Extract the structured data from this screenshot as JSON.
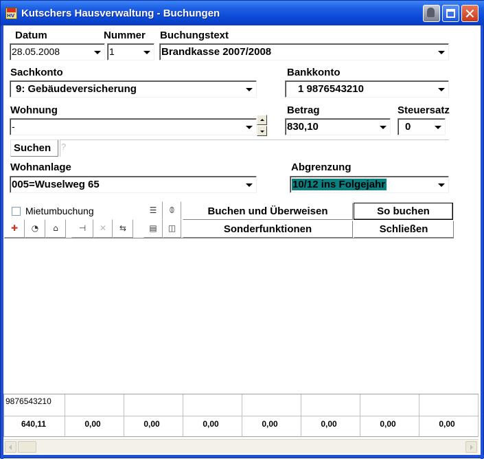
{
  "window": {
    "title": "Kutschers Hausverwaltung - Buchungen",
    "app_icon_text": "HV"
  },
  "labels": {
    "datum": "Datum",
    "nummer": "Nummer",
    "buchungstext": "Buchungstext",
    "sachkonto": "Sachkonto",
    "bankkonto": "Bankkonto",
    "wohnung": "Wohnung",
    "betrag": "Betrag",
    "steuersatz": "Steuersatz",
    "wohnanlage": "Wohnanlage",
    "abgrenzung": "Abgrenzung"
  },
  "fields": {
    "datum": "28.05.2008",
    "nummer": "1",
    "buchungstext": "Brandkasse 2007/2008",
    "sachkonto": "9: Gebäudeversicherung",
    "bankkonto": "1  9876543210",
    "wohnung": "-",
    "betrag": "830,10",
    "steuersatz": "0",
    "wohnanlage": "005=Wuselweg 65",
    "abgrenzung": "10/12 ins Folgejahr"
  },
  "search": {
    "button": "Suchen",
    "hint": "?"
  },
  "checkbox": {
    "label": "Mietumbuchung",
    "checked": false
  },
  "buttons": {
    "buchen_ueberweisen": "Buchen und Überweisen",
    "so_buchen": "So buchen",
    "sonderfunktionen": "Sonderfunktionen",
    "schliessen": "Schließen"
  },
  "toolbar_icons": [
    "list-icon",
    "paperclip-icon",
    "new-entry-icon",
    "piggybank-icon",
    "house-icon",
    "split-icon",
    "delete-icon",
    "transfer-icon",
    "calculator-icon",
    "book-icon"
  ],
  "grid": {
    "header": "9876543210",
    "values": [
      "640,11",
      "0,00",
      "0,00",
      "0,00",
      "0,00",
      "0,00",
      "0,00",
      "0,00"
    ]
  },
  "colors": {
    "title_bar": "#0b48d6",
    "highlight": "#0a8080"
  }
}
